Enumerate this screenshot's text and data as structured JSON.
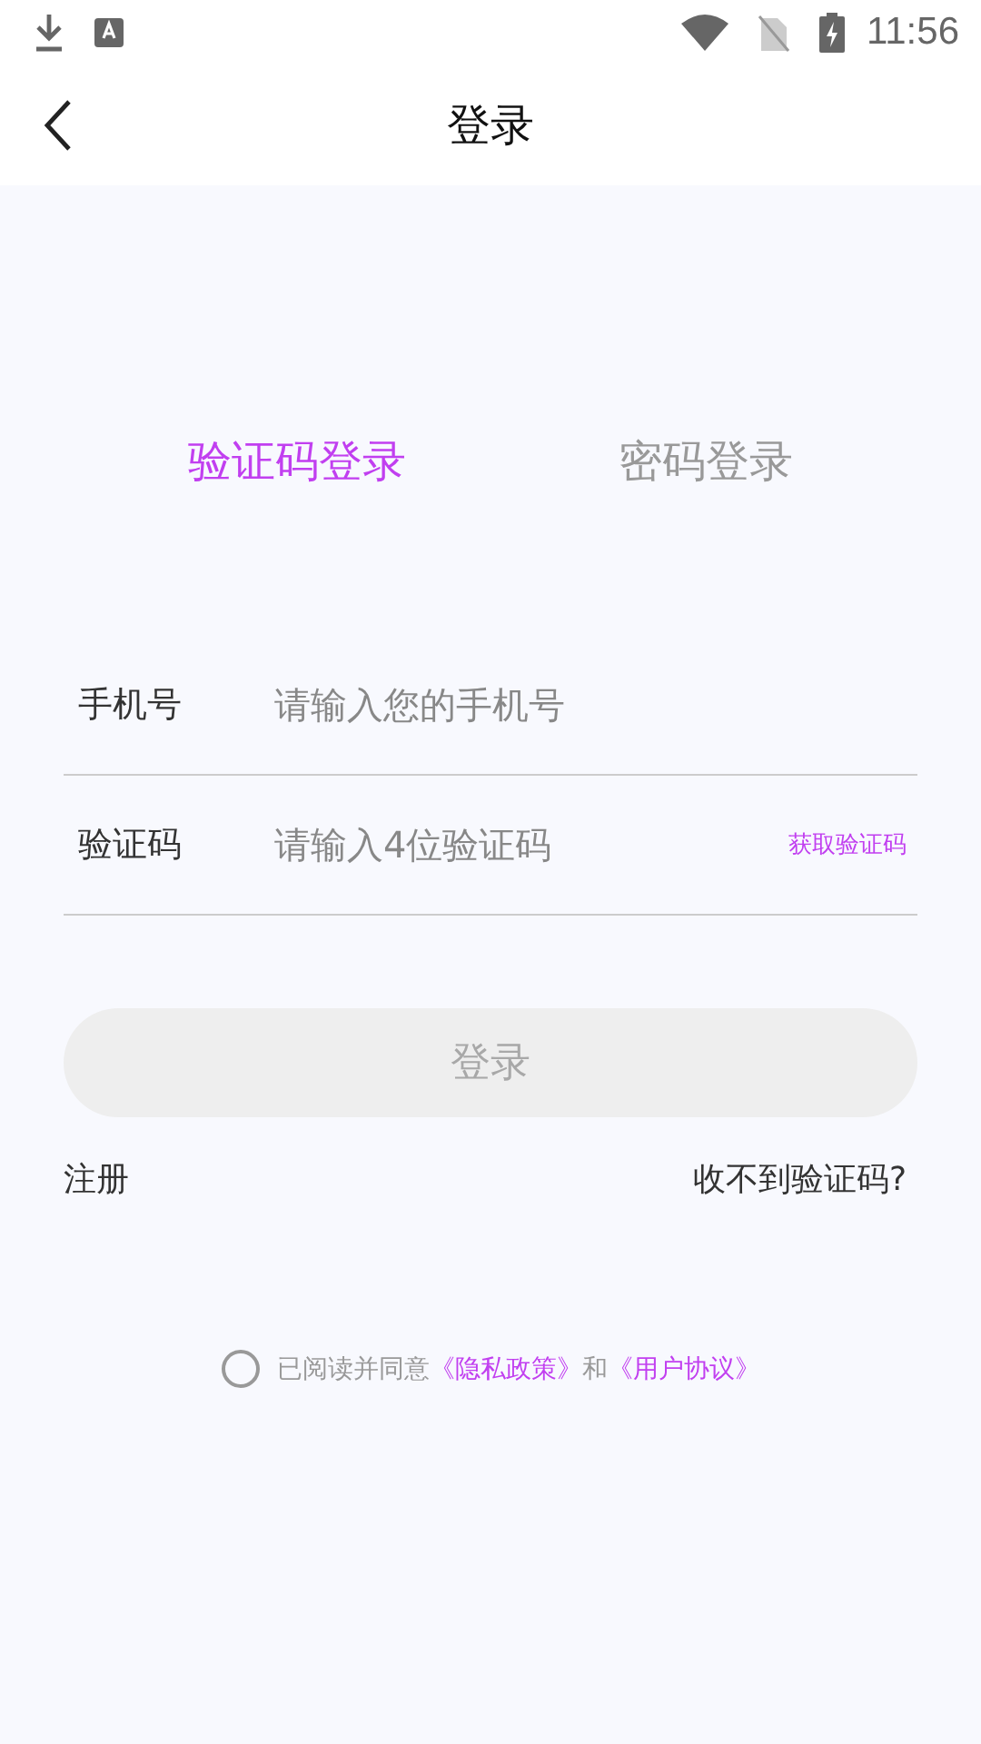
{
  "status_bar": {
    "time": "11:56"
  },
  "header": {
    "title": "登录"
  },
  "tabs": [
    {
      "label": "验证码登录",
      "selected": true
    },
    {
      "label": "密码登录",
      "selected": false
    }
  ],
  "fields": [
    {
      "label": "手机号",
      "placeholder": "请输入您的手机号"
    },
    {
      "label": "验证码",
      "placeholder": "请输入4位验证码",
      "action": "获取验证码"
    }
  ],
  "login_button": {
    "label": "登录",
    "disabled": true
  },
  "links": {
    "register": "注册",
    "no_code": "收不到验证码?"
  },
  "agreement": {
    "checked": false,
    "parts": [
      {
        "kind": "text",
        "text": "已阅读并同意"
      },
      {
        "kind": "link",
        "text": "《隐私政策》"
      },
      {
        "kind": "text",
        "text": "和"
      },
      {
        "kind": "link",
        "text": "《用户协议》"
      }
    ]
  }
}
